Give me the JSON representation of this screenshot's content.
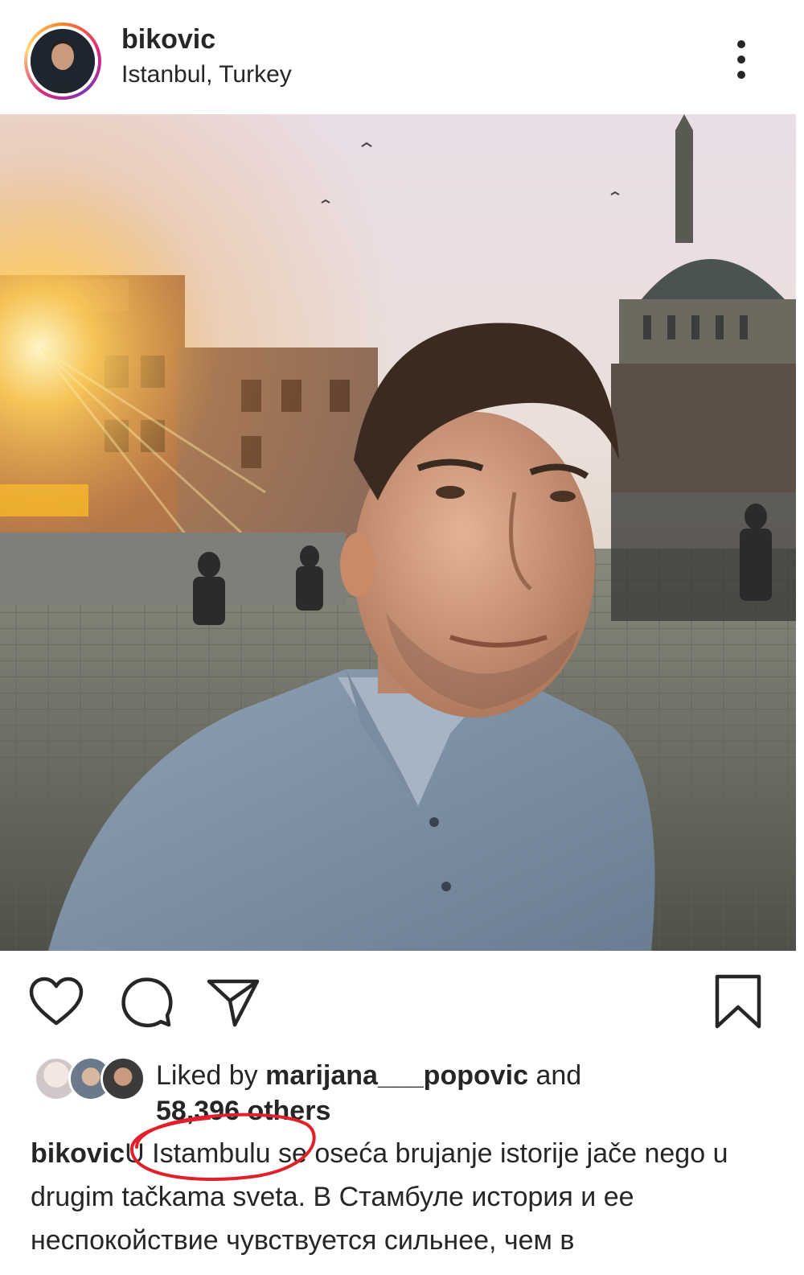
{
  "post": {
    "username": "bikovic",
    "location": "Istanbul, Turkey"
  },
  "likes": {
    "prefix": "Liked by ",
    "liker": "marijana___popovic",
    "middle": " and",
    "others": "58,396 others"
  },
  "caption": {
    "username": "bikovic",
    "text_highlighted": "U Istambulu",
    "text_rest": " se oseća brujanje istorije jače nego u drugim tačkama sveta. В Стамбуле история и ее неспокойствие чувствуется сильнее, чем в"
  },
  "icons": {
    "more": "more-vertical-icon",
    "like": "heart-icon",
    "comment": "comment-icon",
    "share": "paper-plane-icon",
    "save": "bookmark-icon"
  },
  "colors": {
    "annotation": "#e0202a",
    "text": "#262626"
  }
}
